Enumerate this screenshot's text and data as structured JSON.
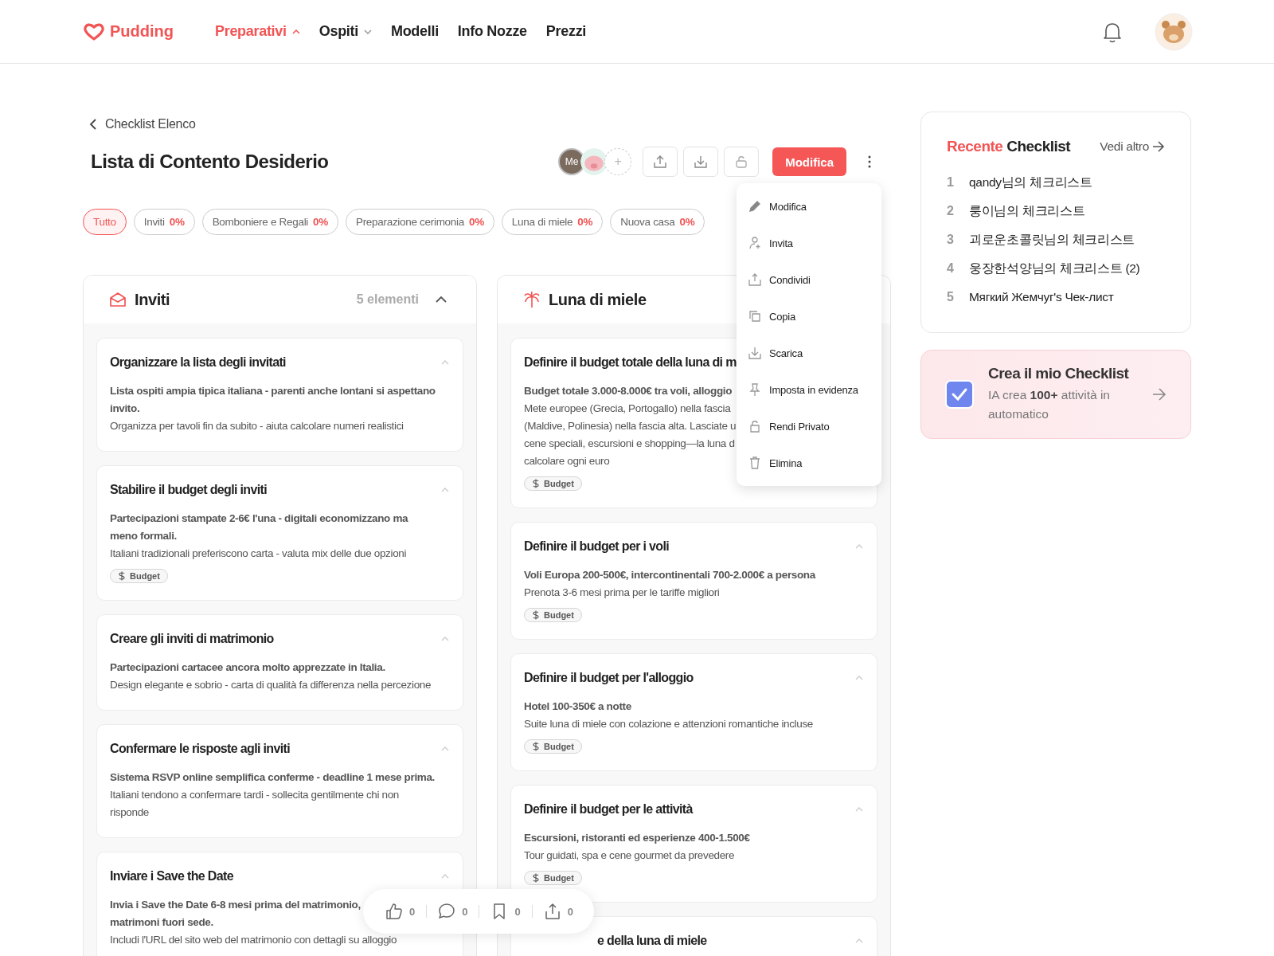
{
  "header": {
    "logo": "Pudding",
    "nav": [
      {
        "label": "Preparativi",
        "selected": true,
        "dropdown": true
      },
      {
        "label": "Ospiti",
        "selected": false,
        "dropdown": true
      },
      {
        "label": "Modelli",
        "selected": false,
        "dropdown": false
      },
      {
        "label": "Info Nozze",
        "selected": false,
        "dropdown": false
      },
      {
        "label": "Prezzi",
        "selected": false,
        "dropdown": false
      }
    ]
  },
  "page": {
    "back": "Checklist Elenco",
    "title": "Lista di Contento Desiderio",
    "avatars": [
      {
        "kind": "text",
        "label": "Me"
      },
      {
        "kind": "picture"
      },
      {
        "kind": "add",
        "label": "+"
      }
    ],
    "edit_button": "Modifica",
    "filters": [
      {
        "label": "Tutto",
        "selected": true
      },
      {
        "label": "Inviti",
        "percent": "0%",
        "selected": false
      },
      {
        "label": "Bomboniere e Regali",
        "percent": "0%",
        "selected": false
      },
      {
        "label": "Preparazione cerimonia",
        "percent": "0%",
        "selected": false
      },
      {
        "label": "Luna di miele",
        "percent": "0%",
        "selected": false
      },
      {
        "label": "Nuova casa",
        "percent": "0%",
        "selected": false
      }
    ],
    "menu": [
      {
        "label": "Modifica"
      },
      {
        "label": "Invita"
      },
      {
        "label": "Condividi"
      },
      {
        "label": "Copia"
      },
      {
        "label": "Scarica"
      },
      {
        "label": "Imposta in evidenza"
      },
      {
        "label": "Rendi Privato"
      },
      {
        "label": "Elimina"
      }
    ],
    "columns": [
      {
        "title": "Inviti",
        "count": "5 elementi",
        "expanded": true,
        "tasks": [
          {
            "title": "Organizzare la lista degli invitati",
            "expanded": true,
            "bold": "Lista ospiti ampia tipica italiana - parenti anche lontani si aspettano invito.",
            "text": "Organizza per tavoli fin da subito - aiuta calcolare numeri realistici"
          },
          {
            "title": "Stabilire il budget degli inviti",
            "expanded": true,
            "bold": "Partecipazioni stampate 2-6€ l'una - digitali economizzano ma meno formali.",
            "text": "Italiani tradizionali preferiscono carta - valuta mix delle due opzioni",
            "tag": "Budget"
          },
          {
            "title": "Creare gli inviti di matrimonio",
            "expanded": true,
            "bold": "Partecipazioni cartacee ancora molto apprezzate in Italia.",
            "text": "Design elegante e sobrio - carta di qualità fa differenza nella percezione"
          },
          {
            "title": "Confermare le risposte agli inviti",
            "expanded": true,
            "bold": "Sistema RSVP online semplifica conferme - deadline 1 mese prima.",
            "text": "Italiani tendono a confermare tardi - sollecita gentilmente chi non risponde"
          },
          {
            "title": "Inviare i Save the Date",
            "expanded": true,
            "bold_lines": [
              "Invia i Save the Date 6-8 mesi prima del matrimonio,",
              "matrimoni fuori sede."
            ],
            "text": "Includi l'URL del sito web del matrimonio con dettagli su alloggio"
          }
        ]
      },
      {
        "title": "Luna di miele",
        "expanded": true,
        "tasks": [
          {
            "title": "Definire il budget totale della luna di m",
            "expanded": true,
            "bold": "Budget totale 3.000-8.000€ tra voli, alloggio",
            "lines": [
              "Mete europee (Grecia, Portogallo) nella fascia",
              "(Maldive, Polinesia) nella fascia alta. Lasciate u",
              "cene speciali, escursioni e shopping—la luna d",
              "calcolare ogni euro"
            ],
            "tag": "Budget"
          },
          {
            "title": "Definire il budget per i voli",
            "expanded": true,
            "bold": "Voli Europa 200-500€, intercontinentali 700-2.000€ a persona",
            "text": "Prenota 3-6 mesi prima per le tariffe migliori",
            "tag": "Budget"
          },
          {
            "title": "Definire il budget per l'alloggio",
            "expanded": true,
            "bold": "Hotel 100-350€ a notte",
            "text": "Suite luna di miele con colazione e attenzioni romantiche incluse",
            "tag": "Budget"
          },
          {
            "title": "Definire il budget per le attività",
            "expanded": true,
            "bold": "Escursioni, ristoranti ed esperienze 400-1.500€",
            "text": "Tour guidati, spa e cene gourmet da prevedere",
            "tag": "Budget"
          },
          {
            "title": "e della luna di miele",
            "expanded": true
          }
        ]
      }
    ]
  },
  "sidebar": {
    "recent": {
      "title_accent": "Recente",
      "title": "Checklist",
      "more": "Vedi altro",
      "items": [
        {
          "num": "1",
          "label": "qandy님의 체크리스트"
        },
        {
          "num": "2",
          "label": "룽이님의 체크리스트"
        },
        {
          "num": "3",
          "label": "괴로운초콜릿님의 체크리스트"
        },
        {
          "num": "4",
          "label": "웅장한석양님의 체크리스트 (2)"
        },
        {
          "num": "5",
          "label": "Мягкий Жемчуг's Чек-лист"
        }
      ]
    },
    "promo": {
      "title": "Crea il mio Checklist",
      "text": "IA crea **100+** attività in automatico"
    }
  },
  "reactions": [
    {
      "count": "0"
    },
    {
      "count": "0"
    },
    {
      "count": "0"
    },
    {
      "count": "0"
    }
  ]
}
